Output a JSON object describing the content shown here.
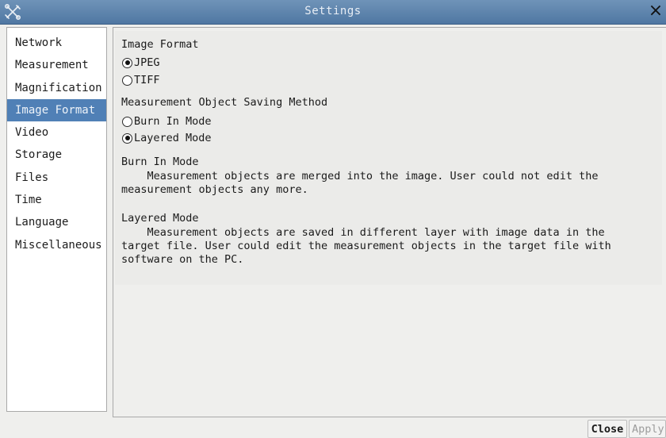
{
  "window": {
    "title": "Settings",
    "close_glyph": "×",
    "app_icon": "tools-icon"
  },
  "sidebar": {
    "items": [
      {
        "label": "Network"
      },
      {
        "label": "Measurement"
      },
      {
        "label": "Magnification"
      },
      {
        "label": "Image Format",
        "active": true
      },
      {
        "label": "Video"
      },
      {
        "label": "Storage"
      },
      {
        "label": "Files"
      },
      {
        "label": "Time"
      },
      {
        "label": "Language"
      },
      {
        "label": "Miscellaneous"
      }
    ],
    "active_color": "#5080b6"
  },
  "image_format": {
    "heading": "Image Format",
    "options": [
      {
        "label": "JPEG",
        "selected": true
      },
      {
        "label": "TIFF",
        "selected": false
      }
    ]
  },
  "saving_method": {
    "heading": "Measurement Object Saving Method",
    "options": [
      {
        "label": "Burn In Mode",
        "selected": false
      },
      {
        "label": "Layered Mode",
        "selected": true
      }
    ]
  },
  "descriptions": {
    "burn_in": {
      "heading": "Burn In Mode",
      "text": "    Measurement objects are merged into the image. User could not edit the\nmeasurement objects any more."
    },
    "layered": {
      "heading": "Layered Mode",
      "text": "    Measurement objects are saved in different layer with image data in the\ntarget file. User could edit the measurement objects in the target file with\nsoftware on the PC."
    }
  },
  "buttons": {
    "close": "Close",
    "apply": "Apply"
  }
}
